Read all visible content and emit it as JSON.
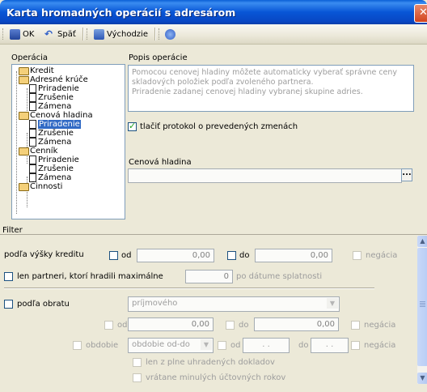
{
  "window": {
    "title": "Karta hromadných operácií s adresárom"
  },
  "toolbar": {
    "ok_label": "OK",
    "back_label": "Späť",
    "defaults_label": "Východzie"
  },
  "operacia": {
    "label": "Operácia",
    "tree": {
      "kredit": "Kredit",
      "adresne_kruce": "Adresné krúče",
      "cenova_hladina": "Cenová hladina",
      "cennik": "Cenník",
      "cinnosti": "Činnosti",
      "priradenie": "Priradenie",
      "zrusenie": "Zrušenie",
      "zamena": "Zámena"
    }
  },
  "popis": {
    "label": "Popis operácie",
    "line1": "Pomocou cenovej hladiny môžete automaticky vyberať správne ceny",
    "line2": "skladových položiek podľa zvoleného partnera.",
    "line3": "Priradenie zadanej cenovej hladiny vybranej skupine adries."
  },
  "tlacit": {
    "label": "tlačiť protokol o prevedených zmenách",
    "checked": true
  },
  "cenova_hladina": {
    "label": "Cenová hladina",
    "value": "",
    "browse": "..."
  },
  "filter": {
    "label": "Filter",
    "kredit": {
      "label": "podľa výšky kreditu",
      "od": "od",
      "od_value": "0,00",
      "do": "do",
      "do_value": "0,00",
      "negacia": "negácia"
    },
    "partneri": {
      "label": "len partneri, ktorí hradili maximálne",
      "value": "0",
      "suffix": "po dátume splatnosti"
    },
    "obrat": {
      "label": "podľa obratu",
      "select": "príjmového",
      "od": "od",
      "od_value": "0,00",
      "do": "do",
      "do_value": "0,00",
      "negacia": "negácia",
      "obdobie": "obdobie",
      "obdobie_select": "obdobie od-do",
      "od2": "od",
      "do2": "do",
      "date_od": ".   .",
      "date_do": ".   .",
      "negacia2": "negácia",
      "plne": "len z plne uhradených dokladov",
      "minule": "vrátane minulých účtovných rokov"
    }
  },
  "colors": {
    "title_bar": "#0a5fd7",
    "selection": "#316ac5",
    "check": "#21a121"
  }
}
